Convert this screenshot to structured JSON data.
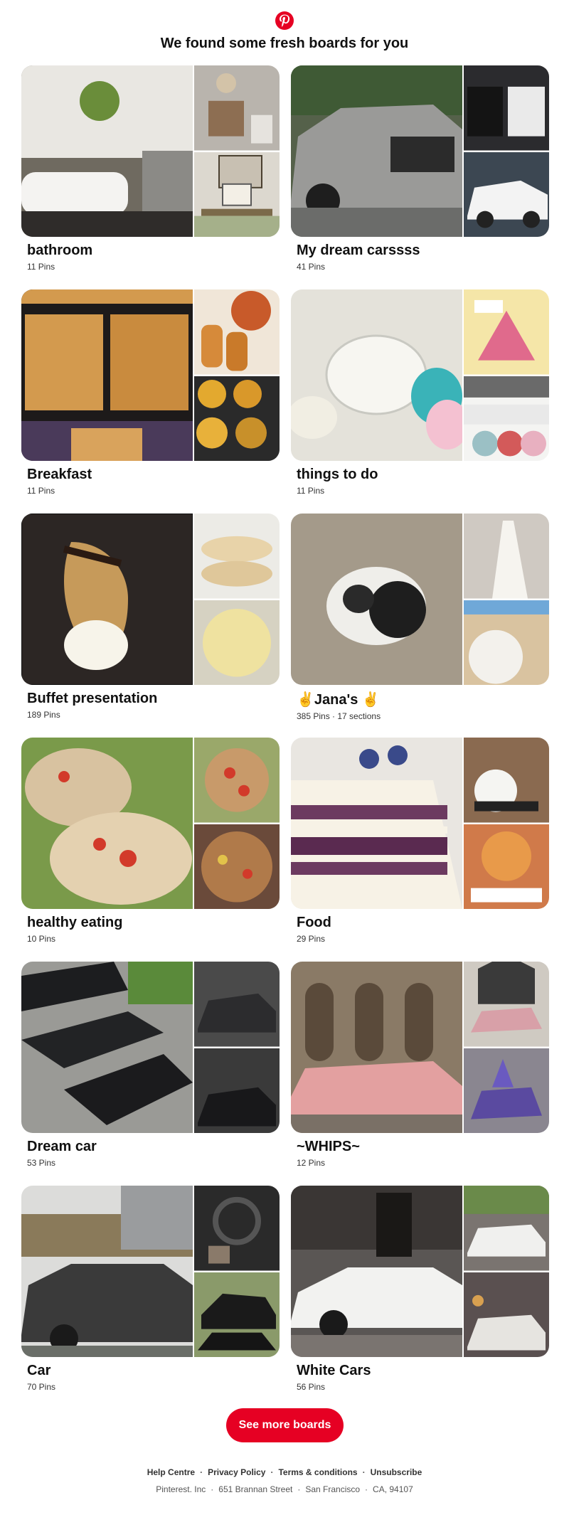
{
  "header": {
    "logo": "pinterest-logo",
    "headline": "We found some fresh boards for you"
  },
  "boards": [
    {
      "title": "bathroom",
      "meta": "11 Pins",
      "colors": [
        "#6f6a60",
        "#8d8174",
        "#7b7a62"
      ]
    },
    {
      "title": "My dream carssss",
      "meta": "41 Pins",
      "colors": [
        "#9a9a98",
        "#2b2b2e",
        "#3c4752"
      ]
    },
    {
      "title": "Breakfast",
      "meta": "11 Pins",
      "colors": [
        "#4c3a2f",
        "#c87d3a",
        "#c79a40"
      ]
    },
    {
      "title": "things to do",
      "meta": "11 Pins",
      "colors": [
        "#e4e2da",
        "#d86a8a",
        "#9aa2a8"
      ]
    },
    {
      "title": "Buffet presentation",
      "meta": "189 Pins",
      "colors": [
        "#3b2a24",
        "#d9c8a8",
        "#e7dc9a"
      ]
    },
    {
      "title": "✌️Jana's ✌️",
      "meta": "385 Pins · 17 sections",
      "colors": [
        "#a49a8a",
        "#cfc9c2",
        "#cdb698"
      ]
    },
    {
      "title": "healthy eating",
      "meta": "10 Pins",
      "colors": [
        "#8aa25a",
        "#b88a58",
        "#9a6a3a"
      ]
    },
    {
      "title": "Food",
      "meta": "29 Pins",
      "colors": [
        "#6c3a60",
        "#8a6a50",
        "#d07a4a"
      ]
    },
    {
      "title": "Dream car",
      "meta": "53 Pins",
      "colors": [
        "#1c1d1f",
        "#2c2c2e",
        "#2a2a2c"
      ]
    },
    {
      "title": "~WHIPS~",
      "meta": "12 Pins",
      "colors": [
        "#8a7a66",
        "#8a8690",
        "#4a3a7a"
      ]
    },
    {
      "title": "Car",
      "meta": "70 Pins",
      "colors": [
        "#6a6e68",
        "#3a3a3a",
        "#3a4a3a"
      ]
    },
    {
      "title": "White Cars",
      "meta": "56 Pins",
      "colors": [
        "#5a5654",
        "#7a7470",
        "#5a5050"
      ]
    }
  ],
  "cta": {
    "label": "See more boards"
  },
  "footer": {
    "links": [
      "Help Centre",
      "Privacy Policy",
      "Terms & conditions",
      "Unsubscribe"
    ],
    "address": [
      "Pinterest. Inc",
      "651 Brannan Street",
      "San Francisco",
      "CA, 94107"
    ]
  }
}
